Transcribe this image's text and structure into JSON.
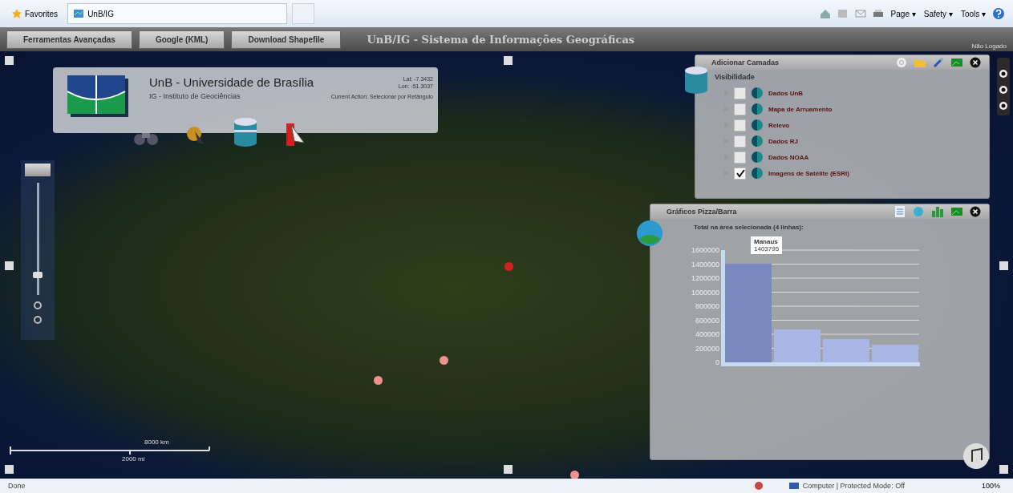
{
  "browser": {
    "favorites": "Favorites",
    "tab": "UnB/IG",
    "commands": [
      "Page ▾",
      "Safety ▾",
      "Tools ▾"
    ]
  },
  "app_bar": {
    "buttons": [
      "Ferramentas Avançadas",
      "Google (KML)",
      "Download Shapefile"
    ],
    "title": "UnB/IG - Sistema de Informações Geográficas",
    "login": "Não Logado"
  },
  "header": {
    "title": "UnB - Universidade de Brasília",
    "subtitle": "IG - Instituto de Geociências",
    "lat": "Lat: -7.3432",
    "lon": "Lon: -51.3037",
    "action": "Current Action: Selecionar por Retângulo"
  },
  "zoom": {
    "level": 0.15
  },
  "scale": {
    "top": "8000 km",
    "bottom": "2000 mi"
  },
  "map_points": [
    {
      "color": "#d02020"
    },
    {
      "color": "#f09090"
    },
    {
      "color": "#f09090"
    },
    {
      "color": "#f09090"
    }
  ],
  "layers": {
    "title": "Adicionar Camadas",
    "section": "Visibilidade",
    "items": [
      {
        "label": "Dados UnB",
        "checked": false
      },
      {
        "label": "Mapa de Arruamento",
        "checked": false
      },
      {
        "label": "Relevo",
        "checked": false
      },
      {
        "label": "Dados RJ",
        "checked": false
      },
      {
        "label": "Dados NOAA",
        "checked": false
      },
      {
        "label": "Imagens de Satélite (ESRI)",
        "checked": true
      }
    ]
  },
  "chart_panel": {
    "title": "Gráficos Pizza/Barra",
    "chart_data": {
      "type": "bar",
      "title": "Total na área selecionada (4 linhas):",
      "grid": true,
      "categories": [
        null,
        null,
        null,
        null
      ],
      "values": [
        1403795,
        470000,
        330000,
        250000
      ],
      "ylim": [
        0,
        1600000
      ],
      "yticks": [
        {
          "value": 0,
          "label": "0"
        },
        {
          "value": 200000,
          "label": "200000"
        },
        {
          "value": 400000,
          "label": "400000"
        },
        {
          "value": 600000,
          "label": "600000"
        },
        {
          "value": 800000,
          "label": "800000"
        },
        {
          "value": 1000000,
          "label": "1000000"
        },
        {
          "value": 1200000,
          "label": "1200000"
        },
        {
          "value": 1400000,
          "label": "1400000"
        },
        {
          "value": 1600000,
          "label": "1600000"
        }
      ]
    },
    "tooltip": {
      "title": "Manaus",
      "value": "1403795"
    }
  },
  "status_bar": {
    "left": "Done",
    "zone": "Computer | Protected Mode: Off",
    "zoom": "100%"
  }
}
